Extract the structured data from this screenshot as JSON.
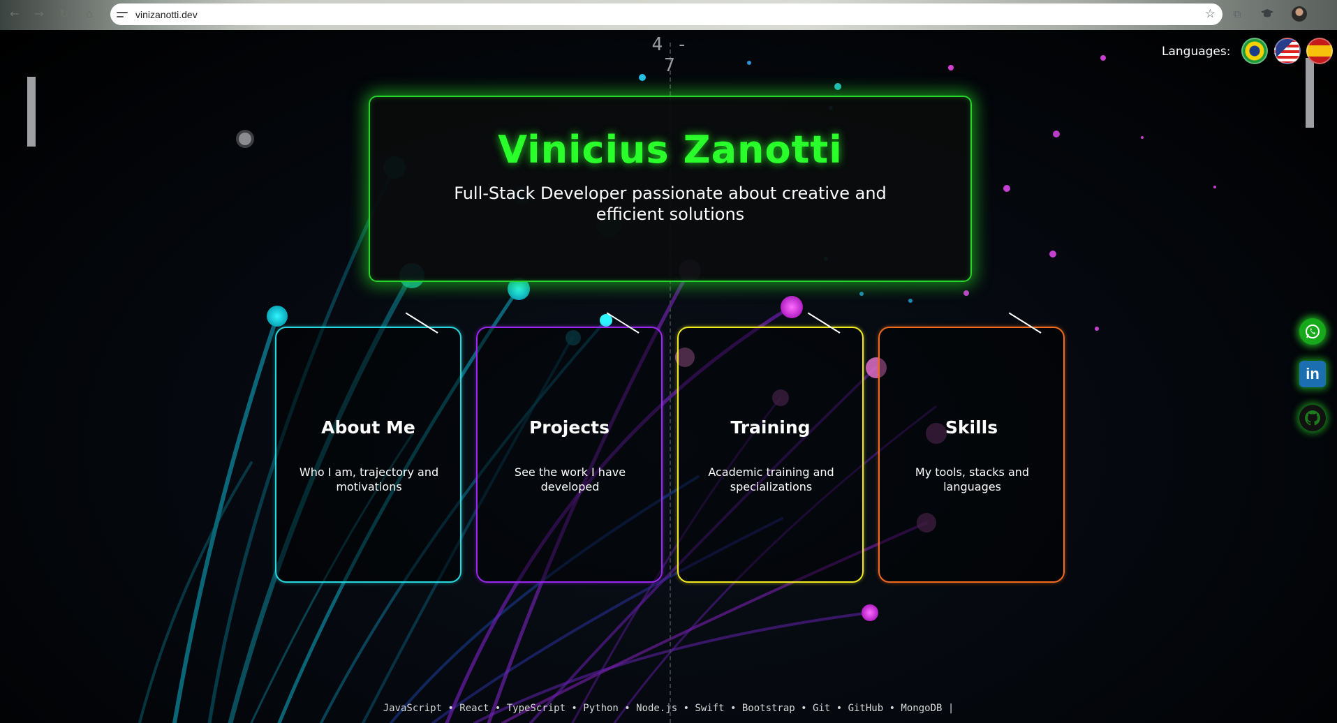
{
  "browser": {
    "url": "vinizanotti.dev",
    "back_icon": "←",
    "forward_icon": "→",
    "reload_icon": "↻",
    "home_icon": "⌂",
    "star_icon": "☆",
    "extensions_icon": "⧉"
  },
  "game": {
    "score": "4 - 7"
  },
  "languages": {
    "label": "Languages:"
  },
  "hero": {
    "title": "Vinicius Zanotti",
    "subtitle": "Full-Stack Developer passionate about creative and efficient solutions"
  },
  "cards": [
    {
      "title": "About Me",
      "description": "Who I am, trajectory and motivations",
      "color": "#27d8e0"
    },
    {
      "title": "Projects",
      "description": "See the work I have developed",
      "color": "#9a27f0"
    },
    {
      "title": "Training",
      "description": "Academic training and specializations",
      "color": "#f0ea1f"
    },
    {
      "title": "Skills",
      "description": "My tools, stacks and languages",
      "color": "#f26a1c"
    }
  ],
  "social": {
    "whatsapp_icon": "whatsapp-icon",
    "linkedin_label": "in",
    "github_icon": "github-icon"
  },
  "tech_ticker": "JavaScript • React • TypeScript • Python • Node.js • Swift • Bootstrap • Git • GitHub • MongoDB |",
  "colors": {
    "accent_green": "#27d42b",
    "background": "#000000"
  }
}
